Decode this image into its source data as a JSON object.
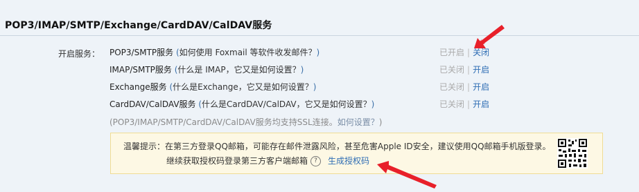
{
  "section": {
    "title": "POP3/IMAP/SMTP/Exchange/CardDAV/CalDAV服务"
  },
  "services_label": "开启服务：",
  "services": [
    {
      "name": "POP3/SMTP服务",
      "help_open": " (",
      "help_link": "如何使用 Foxmail 等软件收发邮件？",
      "help_close": ")",
      "state": "已开启",
      "separator": "|",
      "toggle": "关闭"
    },
    {
      "name": "IMAP/SMTP服务",
      "help_open": " (",
      "help_link": "什么是 IMAP，它又是如何设置？",
      "help_close": ")",
      "state": "已关闭",
      "separator": "|",
      "toggle": "开启"
    },
    {
      "name": "Exchange服务",
      "help_open": " (",
      "help_link": "什么是Exchange，它又是如何设置？",
      "help_close": ")",
      "state": "已关闭",
      "separator": "|",
      "toggle": "开启"
    },
    {
      "name": "CardDAV/CalDAV服务",
      "help_open": " (",
      "help_link": "什么是CardDAV/CalDAV，它又是如何设置？",
      "help_close": ")",
      "state": "已关闭",
      "separator": "|",
      "toggle": "开启"
    }
  ],
  "ssl_note": {
    "text": "(POP3/IMAP/SMTP/CardDAV/CalDAV服务均支持SSL连接。",
    "link": "如何设置？",
    "close": ")"
  },
  "tip": {
    "line1": "温馨提示：在第三方登录QQ邮箱，可能存在邮件泄露风险，甚至危害Apple ID安全，建议使用QQ邮箱手机版登录。",
    "line2": "继续获取授权码登录第三方客户端邮箱",
    "help_icon": "?",
    "generate_link": "生成授权码"
  },
  "colors": {
    "accent": "#2e6db4",
    "arrow": "#e8202a",
    "tip_bg": "#fdf8e4"
  },
  "icons": [
    "help-circle-icon",
    "qr-code-icon",
    "red-arrow-annotation"
  ]
}
